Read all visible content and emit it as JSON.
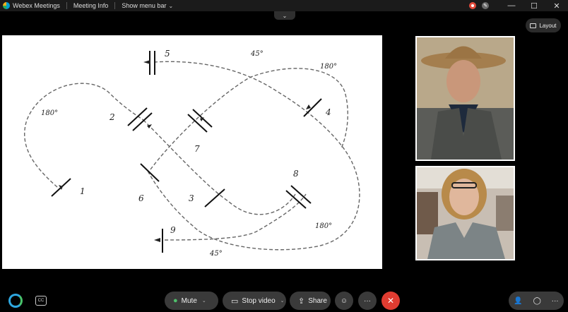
{
  "titlebar": {
    "app_name": "Webex Meetings",
    "meeting_info": "Meeting Info",
    "show_menu_bar": "Show menu bar",
    "minimize": "—",
    "maximize": "☐",
    "close": "✕"
  },
  "layout_button": {
    "label": "Layout"
  },
  "shared_content": {
    "station_labels": [
      "1",
      "2",
      "3",
      "4",
      "5",
      "6",
      "7",
      "8",
      "9"
    ],
    "angle_labels": [
      "180°",
      "45°",
      "180°",
      "180°",
      "45°"
    ]
  },
  "participants": [
    {
      "name": ""
    },
    {
      "name": ""
    }
  ],
  "controls": {
    "cc_label": "CC",
    "mute_label": "Mute",
    "stop_video_label": "Stop video",
    "share_label": "Share",
    "more_label": "···",
    "leave_label": "✕"
  },
  "colors": {
    "mute_icon": "#4fbf6b",
    "leave_button": "#e03c31",
    "recording": "#e24a3b"
  }
}
